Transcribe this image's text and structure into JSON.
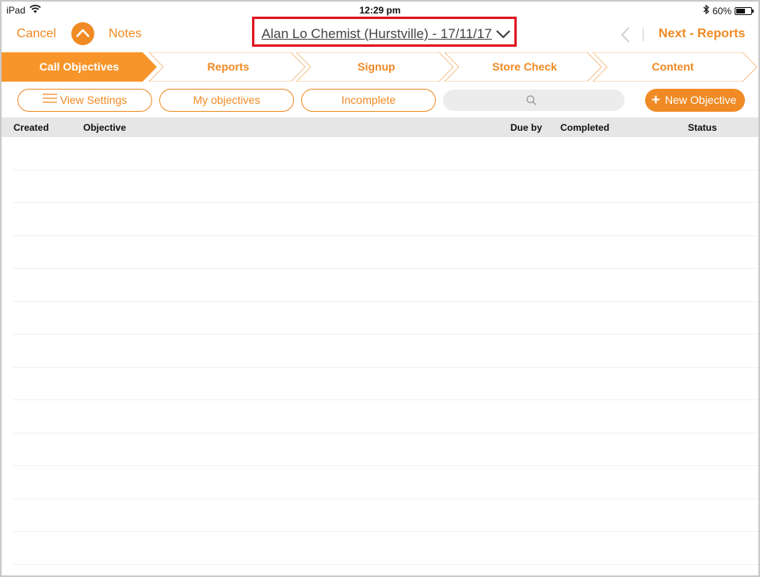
{
  "status_bar": {
    "device": "iPad",
    "time": "12:29 pm",
    "battery": "60%",
    "battery_level": 0.6,
    "icons": [
      "wifi-icon",
      "bluetooth-icon",
      "battery-icon"
    ]
  },
  "nav": {
    "cancel_label": "Cancel",
    "notes_label": "Notes",
    "title": "Alan Lo Chemist (Hurstville) - 17/11/17",
    "next_label": "Next - Reports",
    "icons": [
      "chevron-up-icon",
      "chevron-down-icon",
      "chevron-left-icon"
    ]
  },
  "steps": [
    {
      "label": "Call Objectives",
      "active": true
    },
    {
      "label": "Reports",
      "active": false
    },
    {
      "label": "Signup",
      "active": false
    },
    {
      "label": "Store Check",
      "active": false
    },
    {
      "label": "Content",
      "active": false
    }
  ],
  "filters": {
    "view_settings_label": "View Settings",
    "my_objectives_label": "My objectives",
    "incomplete_label": "Incomplete",
    "search_placeholder": "",
    "new_objective_label": "New Objective"
  },
  "table": {
    "columns": [
      "Created",
      "Objective",
      "Due by",
      "Completed",
      "Status"
    ],
    "rows": []
  },
  "colors": {
    "accent": "#f08a24",
    "highlight_border": "#e0171f",
    "header_bg": "#e6e6e6"
  }
}
